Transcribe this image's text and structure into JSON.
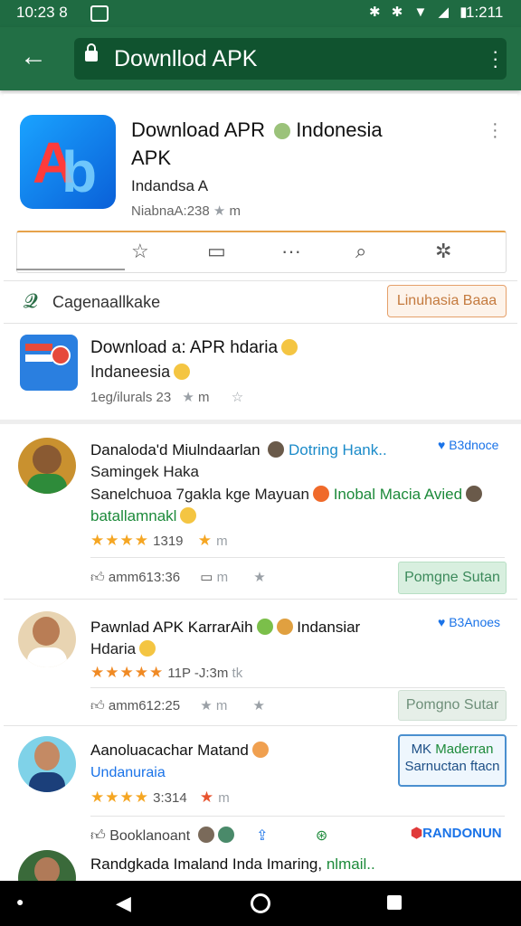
{
  "status_bar": {
    "time_left": "10:23 8",
    "time_right": "1:211",
    "icons": "✱ ✱ ▼ ◢ ▮"
  },
  "app_bar": {
    "url_text": "Downllod APK"
  },
  "app_header": {
    "title_line1": "Download APR",
    "title_line1b": "Indonesia",
    "title_line2": "APK",
    "developer": "Indandsa A",
    "meta": "NiabnaA:238",
    "meta_suffix": "m"
  },
  "category": {
    "label": "Cagenaallkake",
    "button": "Linuhasia Baaa"
  },
  "feature_item": {
    "title": "Download a: APR hdaria",
    "subtitle": "Indaneesia",
    "meta": "1eg/ilurals 23",
    "meta_suffix": "m"
  },
  "posts": [
    {
      "title": "Danaloda'd Miulndaarlan",
      "link": "Dotring Hank..",
      "badge": "B3dnoce",
      "line2": "Samingek Haka",
      "line3a": "Sanelchuoa 7gakla kge Mayuan",
      "line3b": "Inobal Macia Avied",
      "line4": "batallamnakl",
      "rating": "1319",
      "rating_suffix": "m",
      "action_text": "amm613:36",
      "action_suffix": "m",
      "button": "Pomgne Sutan"
    },
    {
      "title": "Pawnlad APK KarrarAih",
      "title_b": "Indansiar",
      "badge": "B3Anoes",
      "line2": "Hdaria",
      "rating": "11P",
      "rating_b": "-J:3m",
      "rating_c": "tk",
      "action_text": "amm612:25",
      "action_suffix": "m",
      "button": "Pomgno Sutar"
    },
    {
      "title": "Aanoluacachar Matand",
      "subtitle": "Undanuraia",
      "rating": "3:314",
      "rating_suffix": "m",
      "box_line1": "MK",
      "box_line1b": "Maderran",
      "box_line2": "Sarnuctan ftacn",
      "footer_text": "Booklanoant",
      "footer_badge": "RANDONUN"
    },
    {
      "title": "Randgkada Imaland Inda Imaring,",
      "title_b": "nlmail.."
    }
  ],
  "colors": {
    "app_bar": "#226f45",
    "status_bar": "#1f6b42",
    "accent_orange": "#e6a24a",
    "link_blue": "#1a73e8",
    "green": "#1c8a3a"
  },
  "nav_bar": {
    "icons": [
      "dot-icon",
      "back-triangle-icon",
      "home-circle-icon",
      "recents-square-icon"
    ]
  }
}
